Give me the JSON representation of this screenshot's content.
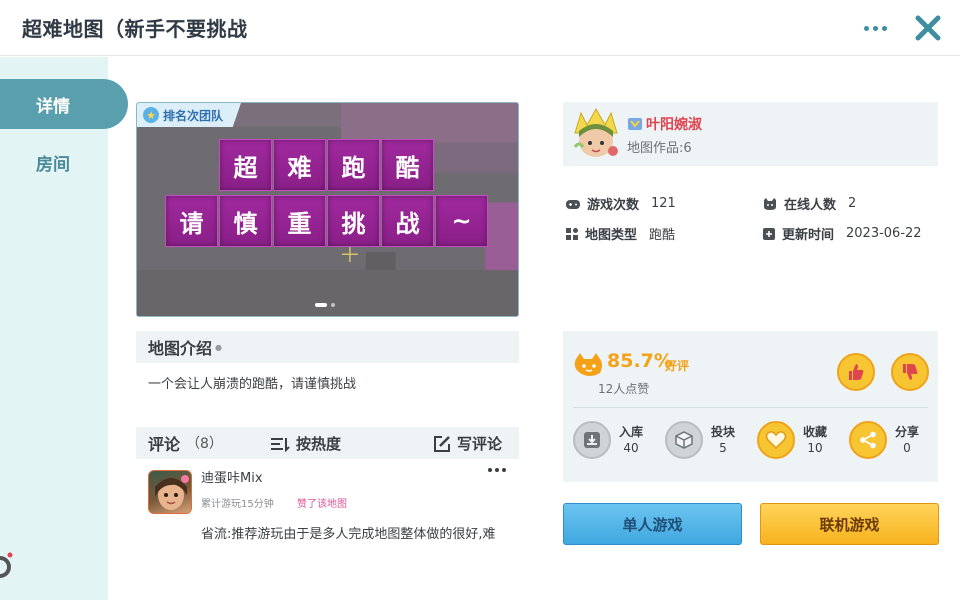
{
  "header": {
    "title": "超难地图（新手不要挑战"
  },
  "sidebar": {
    "tabs": [
      {
        "label": "详情"
      },
      {
        "label": "房间"
      }
    ]
  },
  "banner": {
    "badge": "排名次团队",
    "row1": [
      "超",
      "难",
      "跑",
      "酷"
    ],
    "row2": [
      "请",
      "慎",
      "重",
      "挑",
      "战",
      "~"
    ],
    "pages": 2,
    "current_page": 1
  },
  "intro": {
    "title": "地图介绍",
    "text": "一个会让人崩溃的跑酷，请谨慎挑战"
  },
  "comments": {
    "title": "评论",
    "count": "（8）",
    "sort_label": "按热度",
    "write_label": "写评论",
    "items": [
      {
        "name": "迪蛋咔Mix",
        "meta": "累计游玩15分钟",
        "liked": "赞了该地图",
        "text": "省流:推荐游玩由于是多人完成地图整体做的很好,难"
      }
    ]
  },
  "author": {
    "name": "叶阳婉淑",
    "works": "地图作品:6"
  },
  "stats": {
    "plays_label": "游戏次数",
    "plays": "121",
    "online_label": "在线人数",
    "online": "2",
    "type_label": "地图类型",
    "type": "跑酷",
    "updated_label": "更新时间",
    "updated": "2023-06-22"
  },
  "rating": {
    "percent": "85.7%",
    "word": "好评",
    "likes": "12人点赞",
    "actions": [
      {
        "label": "入库",
        "value": "40"
      },
      {
        "label": "投块",
        "value": "5"
      },
      {
        "label": "收藏",
        "value": "10"
      },
      {
        "label": "分享",
        "value": "0"
      }
    ]
  },
  "buttons": {
    "single": "单人游戏",
    "multi": "联机游戏"
  },
  "colors": {
    "accent": "#5a9fad",
    "sidebar_bg": "#e3f4f5",
    "rating": "#f5a219",
    "tile": "#a0299e",
    "single_btn": "#3fa8e0",
    "multi_btn": "#f7b21e"
  }
}
